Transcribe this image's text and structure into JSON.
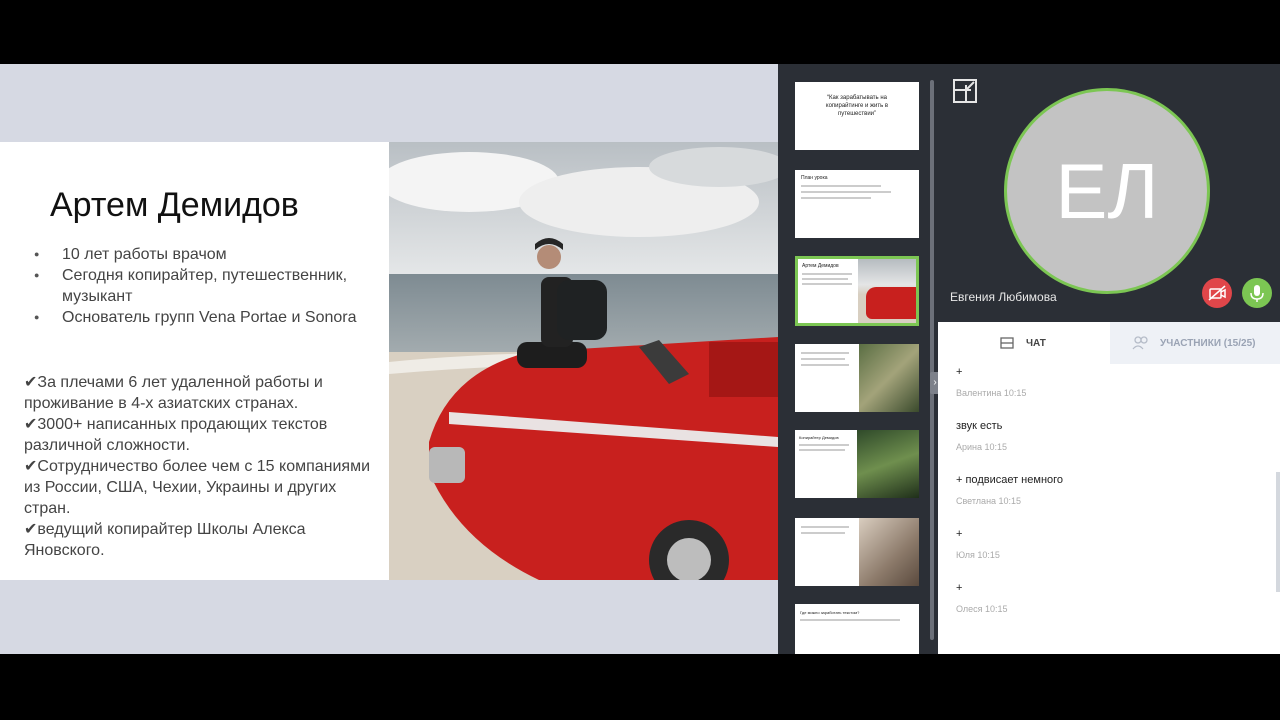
{
  "slide": {
    "title": "Артем Демидов",
    "bullets": [
      "10 лет работы врачом",
      "Сегодня копирайтер, путешественник, музыкант",
      "Основатель групп Vena Portae и Sonora"
    ],
    "checks": [
      "✔За плечами 6 лет удаленной работы и проживание в 4-х азиатских странах.",
      "✔3000+ написанных продающих текстов различной сложности.",
      "✔Сотрудничество более чем с 15 компаниями из России, США, Чехии, Украины и других стран.",
      "✔ведущий копирайтер Школы Алекса Яновского."
    ]
  },
  "thumbnails": {
    "t1_text": "“Как зарабатывать на копирайтинге и жить в путешествии”",
    "t2_title": "План урока",
    "t3_title": "Артем Демидов",
    "t5_title": "Копирайтер Демидов",
    "t7_title": "Где можно заработать текстом?"
  },
  "video": {
    "initials": "ЕЛ",
    "speaker_name": "Евгения Любимова"
  },
  "colors": {
    "accent": "#7cc653",
    "mute": "#e0464a"
  },
  "chat": {
    "tab_chat": "ЧАТ",
    "tab_participants": "УЧАСТНИКИ (15/25)",
    "messages": [
      {
        "text": "+",
        "meta": "Валентина   10:15"
      },
      {
        "text": "звук есть",
        "meta": "Арина   10:15"
      },
      {
        "text": "+ подвисает немного",
        "meta": "Светлана   10:15"
      },
      {
        "text": "+",
        "meta": "Юля   10:15"
      },
      {
        "text": "+",
        "meta": "Олеся   10:15"
      }
    ]
  }
}
